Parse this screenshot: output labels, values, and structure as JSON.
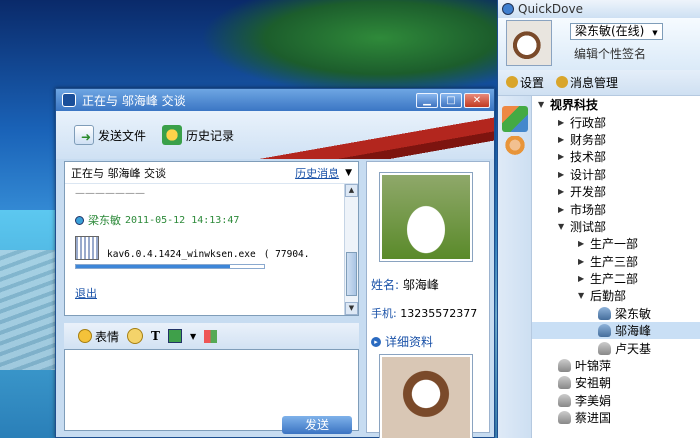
{
  "chat_window": {
    "title": "正在与 邬海峰 交谈",
    "toolbar": {
      "send_file": "发送文件",
      "history": "历史记录"
    },
    "message_header": {
      "text": "正在与 邬海峰 交谈",
      "history_link": "历史消息"
    },
    "message": {
      "previous_line": "———————",
      "sender": "梁东敏",
      "timestamp": "2011-05-12 14:13:47",
      "file_name": "kav6.0.4.1424_winwksen.exe",
      "file_size": "( 77904.",
      "progress": 0.82,
      "cancel_link": "退出"
    },
    "input_toolbar": {
      "emoji_label": "表情"
    },
    "send_button": "发送",
    "contact_card": {
      "name_label": "姓名:",
      "name": "邬海峰",
      "phone_label": "手机:",
      "phone": "13235572377",
      "details_link": "详细资料"
    }
  },
  "main_window": {
    "title": "QuickDove",
    "user_status": "梁东敏(在线)",
    "signature_placeholder": "编辑个性签名",
    "menu": {
      "settings": "设置",
      "messages": "消息管理"
    },
    "tree": [
      {
        "label": "视界科技",
        "level": 0,
        "expanded": true,
        "type": "group"
      },
      {
        "label": "行政部",
        "level": 1,
        "expanded": false,
        "type": "group"
      },
      {
        "label": "财务部",
        "level": 1,
        "expanded": false,
        "type": "group"
      },
      {
        "label": "技术部",
        "level": 1,
        "expanded": false,
        "type": "group"
      },
      {
        "label": "设计部",
        "level": 1,
        "expanded": false,
        "type": "group"
      },
      {
        "label": "开发部",
        "level": 1,
        "expanded": false,
        "type": "group"
      },
      {
        "label": "市场部",
        "level": 1,
        "expanded": false,
        "type": "group"
      },
      {
        "label": "测试部",
        "level": 1,
        "expanded": true,
        "type": "group"
      },
      {
        "label": "生产一部",
        "level": 2,
        "expanded": false,
        "type": "group"
      },
      {
        "label": "生产三部",
        "level": 2,
        "expanded": false,
        "type": "group"
      },
      {
        "label": "生产二部",
        "level": 2,
        "expanded": false,
        "type": "group"
      },
      {
        "label": "后勤部",
        "level": 2,
        "expanded": true,
        "type": "group"
      },
      {
        "label": "梁东敏",
        "level": 3,
        "type": "user",
        "online": true
      },
      {
        "label": "邬海峰",
        "level": 3,
        "type": "user",
        "online": true,
        "selected": true
      },
      {
        "label": "卢天基",
        "level": 3,
        "type": "user",
        "online": false
      },
      {
        "label": "叶锦萍",
        "level": 1,
        "type": "user",
        "online": false
      },
      {
        "label": "安祖朝",
        "level": 1,
        "type": "user",
        "online": false
      },
      {
        "label": "李美娟",
        "level": 1,
        "type": "user",
        "online": false
      },
      {
        "label": "蔡进国",
        "level": 1,
        "type": "user",
        "online": false
      }
    ]
  },
  "colors": {
    "accent": "#3b76c4",
    "link": "#1a52a8",
    "sender": "#2d8a3a",
    "selected_row": "#c9dff5"
  }
}
